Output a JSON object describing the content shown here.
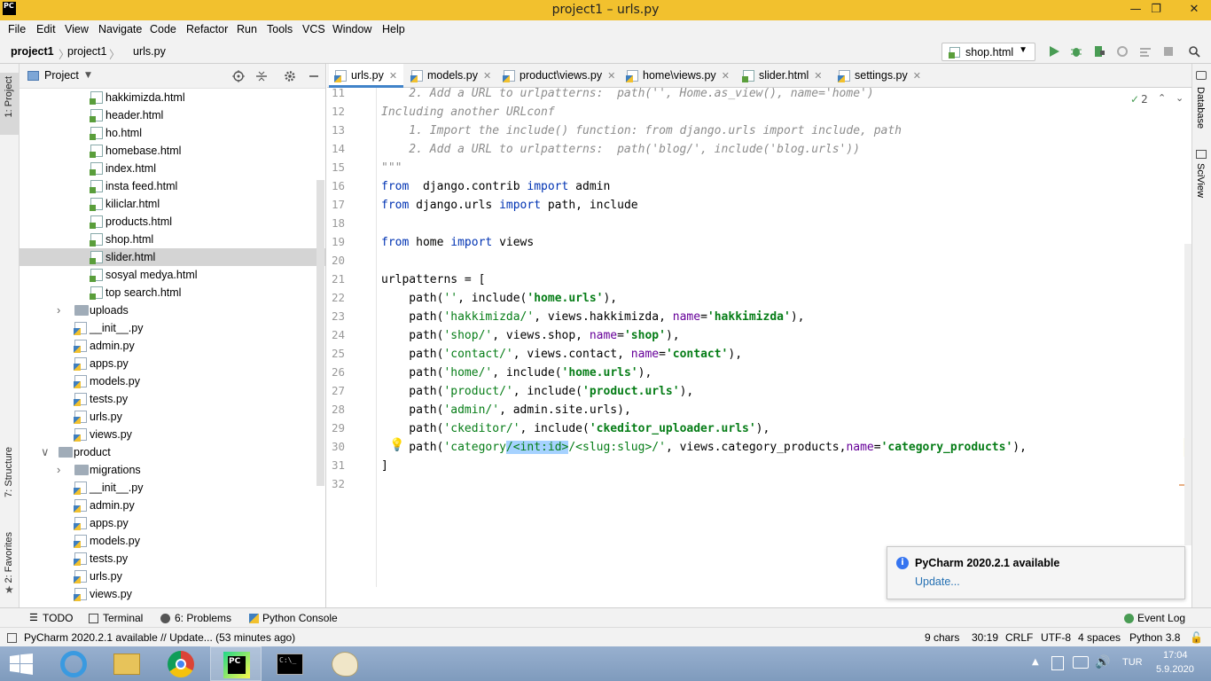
{
  "window": {
    "title": "project1 – urls.py",
    "logo": "PC"
  },
  "menu": [
    "File",
    "Edit",
    "View",
    "Navigate",
    "Code",
    "Refactor",
    "Run",
    "Tools",
    "VCS",
    "Window",
    "Help"
  ],
  "breadcrumb": [
    "project1",
    "project1",
    "urls.py"
  ],
  "run_config": "shop.html",
  "project_panel": {
    "title": "Project"
  },
  "tree": [
    {
      "label": "hakkimizda.html",
      "type": "html",
      "depth": 4
    },
    {
      "label": "header.html",
      "type": "html",
      "depth": 4
    },
    {
      "label": "ho.html",
      "type": "html",
      "depth": 4
    },
    {
      "label": "homebase.html",
      "type": "html",
      "depth": 4
    },
    {
      "label": "index.html",
      "type": "html",
      "depth": 4
    },
    {
      "label": "insta feed.html",
      "type": "html",
      "depth": 4
    },
    {
      "label": "kiliclar.html",
      "type": "html",
      "depth": 4
    },
    {
      "label": "products.html",
      "type": "html",
      "depth": 4
    },
    {
      "label": "shop.html",
      "type": "html",
      "depth": 4
    },
    {
      "label": "slider.html",
      "type": "html",
      "depth": 4,
      "selected": true
    },
    {
      "label": "sosyal medya.html",
      "type": "html",
      "depth": 4
    },
    {
      "label": "top search.html",
      "type": "html",
      "depth": 4
    },
    {
      "label": "uploads",
      "type": "folder",
      "depth": 3,
      "arrow": "right"
    },
    {
      "label": "__init__.py",
      "type": "py",
      "depth": 3
    },
    {
      "label": "admin.py",
      "type": "py",
      "depth": 3
    },
    {
      "label": "apps.py",
      "type": "py",
      "depth": 3
    },
    {
      "label": "models.py",
      "type": "py",
      "depth": 3
    },
    {
      "label": "tests.py",
      "type": "py",
      "depth": 3
    },
    {
      "label": "urls.py",
      "type": "py",
      "depth": 3
    },
    {
      "label": "views.py",
      "type": "py",
      "depth": 3
    },
    {
      "label": "product",
      "type": "folder",
      "depth": 2,
      "arrow": "down"
    },
    {
      "label": "migrations",
      "type": "folder",
      "depth": 3,
      "arrow": "right"
    },
    {
      "label": "__init__.py",
      "type": "py",
      "depth": 3
    },
    {
      "label": "admin.py",
      "type": "py",
      "depth": 3
    },
    {
      "label": "apps.py",
      "type": "py",
      "depth": 3
    },
    {
      "label": "models.py",
      "type": "py",
      "depth": 3
    },
    {
      "label": "tests.py",
      "type": "py",
      "depth": 3
    },
    {
      "label": "urls.py",
      "type": "py",
      "depth": 3
    },
    {
      "label": "views.py",
      "type": "py",
      "depth": 3
    }
  ],
  "tabs": [
    {
      "label": "urls.py",
      "type": "py",
      "active": true
    },
    {
      "label": "models.py",
      "type": "py"
    },
    {
      "label": "product\\views.py",
      "type": "py"
    },
    {
      "label": "home\\views.py",
      "type": "py"
    },
    {
      "label": "slider.html",
      "type": "html"
    },
    {
      "label": "settings.py",
      "type": "py"
    }
  ],
  "inspection": {
    "count": "2"
  },
  "code_lines": [
    {
      "n": "11",
      "parts": [
        [
          "cmt",
          "    2. Add a URL to urlpatterns:  path('', Home.as_view(), name='home')"
        ]
      ]
    },
    {
      "n": "12",
      "parts": [
        [
          "cmt",
          "Including another URLconf"
        ]
      ]
    },
    {
      "n": "13",
      "parts": [
        [
          "cmt",
          "    1. Import the include() function: from django.urls import include, path"
        ]
      ]
    },
    {
      "n": "14",
      "parts": [
        [
          "cmt",
          "    2. Add a URL to urlpatterns:  path('blog/', include('blog.urls'))"
        ]
      ]
    },
    {
      "n": "15",
      "parts": [
        [
          "cmt",
          "\"\"\""
        ]
      ]
    },
    {
      "n": "16",
      "parts": [
        [
          "kw",
          "from"
        ],
        [
          "",
          "  django.contrib "
        ],
        [
          "kw",
          "import"
        ],
        [
          "",
          " admin"
        ]
      ]
    },
    {
      "n": "17",
      "parts": [
        [
          "kw",
          "from"
        ],
        [
          "",
          " django.urls "
        ],
        [
          "kw",
          "import"
        ],
        [
          "",
          " path, include"
        ]
      ]
    },
    {
      "n": "18",
      "parts": []
    },
    {
      "n": "19",
      "parts": [
        [
          "kw",
          "from"
        ],
        [
          "",
          " home "
        ],
        [
          "kw",
          "import"
        ],
        [
          "",
          " views"
        ]
      ]
    },
    {
      "n": "20",
      "parts": []
    },
    {
      "n": "21",
      "parts": [
        [
          "",
          "urlpatterns = ["
        ]
      ]
    },
    {
      "n": "22",
      "parts": [
        [
          "",
          "    path("
        ],
        [
          "strp",
          "''"
        ],
        [
          "",
          ", include("
        ],
        [
          "str",
          "'home.urls'"
        ],
        [
          "",
          "),"
        ]
      ]
    },
    {
      "n": "23",
      "parts": [
        [
          "",
          "    path("
        ],
        [
          "strp",
          "'hakkimizda/'"
        ],
        [
          "",
          ", views.hakkimizda, "
        ],
        [
          "par",
          "name"
        ],
        [
          "",
          "="
        ],
        [
          "str",
          "'hakkimizda'"
        ],
        [
          "",
          "),"
        ]
      ]
    },
    {
      "n": "24",
      "parts": [
        [
          "",
          "    path("
        ],
        [
          "strp",
          "'shop/'"
        ],
        [
          "",
          ", views.shop, "
        ],
        [
          "par",
          "name"
        ],
        [
          "",
          "="
        ],
        [
          "str",
          "'shop'"
        ],
        [
          "",
          "),"
        ]
      ]
    },
    {
      "n": "25",
      "parts": [
        [
          "",
          "    path("
        ],
        [
          "strp",
          "'contact/'"
        ],
        [
          "",
          ", views.contact, "
        ],
        [
          "par",
          "name"
        ],
        [
          "",
          "="
        ],
        [
          "str",
          "'contact'"
        ],
        [
          "",
          "),"
        ]
      ]
    },
    {
      "n": "26",
      "parts": [
        [
          "",
          "    path("
        ],
        [
          "strp",
          "'home/'"
        ],
        [
          "",
          ", include("
        ],
        [
          "str",
          "'home.urls'"
        ],
        [
          "",
          "),"
        ]
      ]
    },
    {
      "n": "27",
      "parts": [
        [
          "",
          "    path("
        ],
        [
          "strp",
          "'product/'"
        ],
        [
          "",
          ", include("
        ],
        [
          "str",
          "'product.urls'"
        ],
        [
          "",
          "),"
        ]
      ]
    },
    {
      "n": "28",
      "parts": [
        [
          "",
          "    path("
        ],
        [
          "strp",
          "'admin/'"
        ],
        [
          "",
          ", admin.site.urls),"
        ]
      ]
    },
    {
      "n": "29",
      "parts": [
        [
          "",
          "    path("
        ],
        [
          "strp",
          "'ckeditor/'"
        ],
        [
          "",
          ", include("
        ],
        [
          "str",
          "'ckeditor_uploader.urls'"
        ],
        [
          "",
          "),"
        ]
      ]
    },
    {
      "n": "30",
      "parts": [
        [
          "",
          "    path("
        ],
        [
          "strp",
          "'category"
        ],
        [
          "sel",
          "/<int:id>"
        ],
        [
          "strp",
          "/<slug:slug>/'"
        ],
        [
          "",
          ", views.category_products,"
        ],
        [
          "par",
          "name"
        ],
        [
          "",
          "="
        ],
        [
          "str",
          "'category_products'"
        ],
        [
          "",
          "),"
        ]
      ]
    },
    {
      "n": "31",
      "parts": [
        [
          "",
          "]"
        ]
      ]
    },
    {
      "n": "32",
      "parts": []
    }
  ],
  "notification": {
    "title": "PyCharm 2020.2.1 available",
    "link": "Update..."
  },
  "bottom_tools": [
    "TODO",
    "Terminal",
    "6: Problems",
    "Python Console"
  ],
  "event_log": "Event Log",
  "status": {
    "message": "PyCharm 2020.2.1 available // Update... (53 minutes ago)",
    "chars": "9 chars",
    "position": "30:19",
    "line_sep": "CRLF",
    "encoding": "UTF-8",
    "indent": "4 spaces",
    "interpreter": "Python 3.8"
  },
  "left_strip": [
    "1: Project",
    "7: Structure",
    "2: Favorites"
  ],
  "right_strip": [
    "Database",
    "SciView"
  ],
  "taskbar": {
    "lang": "TUR",
    "time": "17:04",
    "date": "5.9.2020"
  }
}
